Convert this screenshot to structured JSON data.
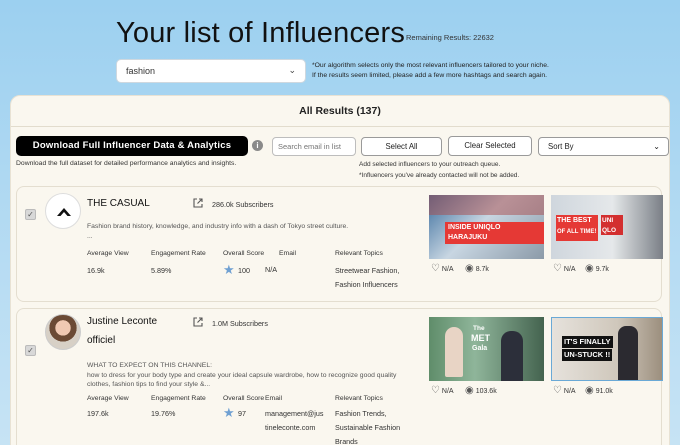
{
  "header": {
    "title": "Your list of Influencers",
    "remaining": "Remaining Results: 22632",
    "topic_value": "fashion",
    "algo_note_1": "*Our algorithm selects only the most relevant influencers tailored to your niche.",
    "algo_note_2": "If the results seem limited, please add a few more hashtags and search again."
  },
  "results": {
    "title": "All Results (137)",
    "download_label": "Download Full Influencer Data & Analytics",
    "download_note": "Download the full dataset for detailed performance analytics and insights.",
    "search_placeholder": "Search email in list",
    "select_all_label": "Select All",
    "clear_selected_label": "Clear Selected",
    "sort_by_label": "Sort By",
    "outreach_note_1": "Add selected influencers to your outreach queue.",
    "outreach_note_2": "*Influencers you've already contacted will not be added."
  },
  "labels": {
    "average_view": "Average View",
    "engagement_rate": "Engagement Rate",
    "overall_score": "Overall Score",
    "email": "Email",
    "relevant_topics": "Relevant Topics"
  },
  "influencers": [
    {
      "name": "THE CASUAL",
      "subscribers": "286.0k Subscribers",
      "description_1": "Fashion brand history, knowledge, and industry info with a dash of Tokyo street culture.",
      "description_2": "...",
      "average_view": "16.9k",
      "engagement_rate": "5.89%",
      "overall_score": "100",
      "email": "N/A",
      "topic_1": "Streetwear Fashion,",
      "topic_2": "Fashion Influencers",
      "videos": [
        {
          "likes": "N/A",
          "views": "8.7k",
          "thumb_text": "INSIDE UNIQLO HARAJUKU"
        },
        {
          "likes": "N/A",
          "views": "9.7k",
          "thumb_text_1": "THE BEST",
          "thumb_text_2": "OF ALL TIME!",
          "thumb_text_3": "UNI QLO"
        }
      ]
    },
    {
      "name_1": "Justine Leconte",
      "name_2": "officiel",
      "subscribers": "1.0M Subscribers",
      "description_1": "WHAT TO EXPECT ON THIS CHANNEL:",
      "description_2": "how to dress for your body type and create your ideal capsule wardrobe, how to recognize good quality",
      "description_3": "clothes, fashion tips to find your style &...",
      "average_view": "197.6k",
      "engagement_rate": "19.76%",
      "overall_score": "97",
      "email_1": "management@jus",
      "email_2": "tineleconte.com",
      "topic_1": "Fashion Trends,",
      "topic_2": "Sustainable Fashion",
      "topic_3": "Brands",
      "videos": [
        {
          "likes": "N/A",
          "views": "103.6k",
          "thumb_text_1": "The",
          "thumb_text_2": "MET",
          "thumb_text_3": "Gala"
        },
        {
          "likes": "N/A",
          "views": "91.0k",
          "thumb_text_1": "IT'S FINALLY",
          "thumb_text_2": "UN-STUCK !!"
        }
      ]
    }
  ],
  "colors": {
    "accent_star": "#6fa0d2",
    "thumb_red": "#e53935",
    "download_bg": "#000000"
  },
  "icons": {
    "dropdown": "chevron-down-icon",
    "info": "info-icon",
    "external": "external-link-icon",
    "score": "star-icon",
    "likes": "heart-icon",
    "views": "eye-icon"
  }
}
